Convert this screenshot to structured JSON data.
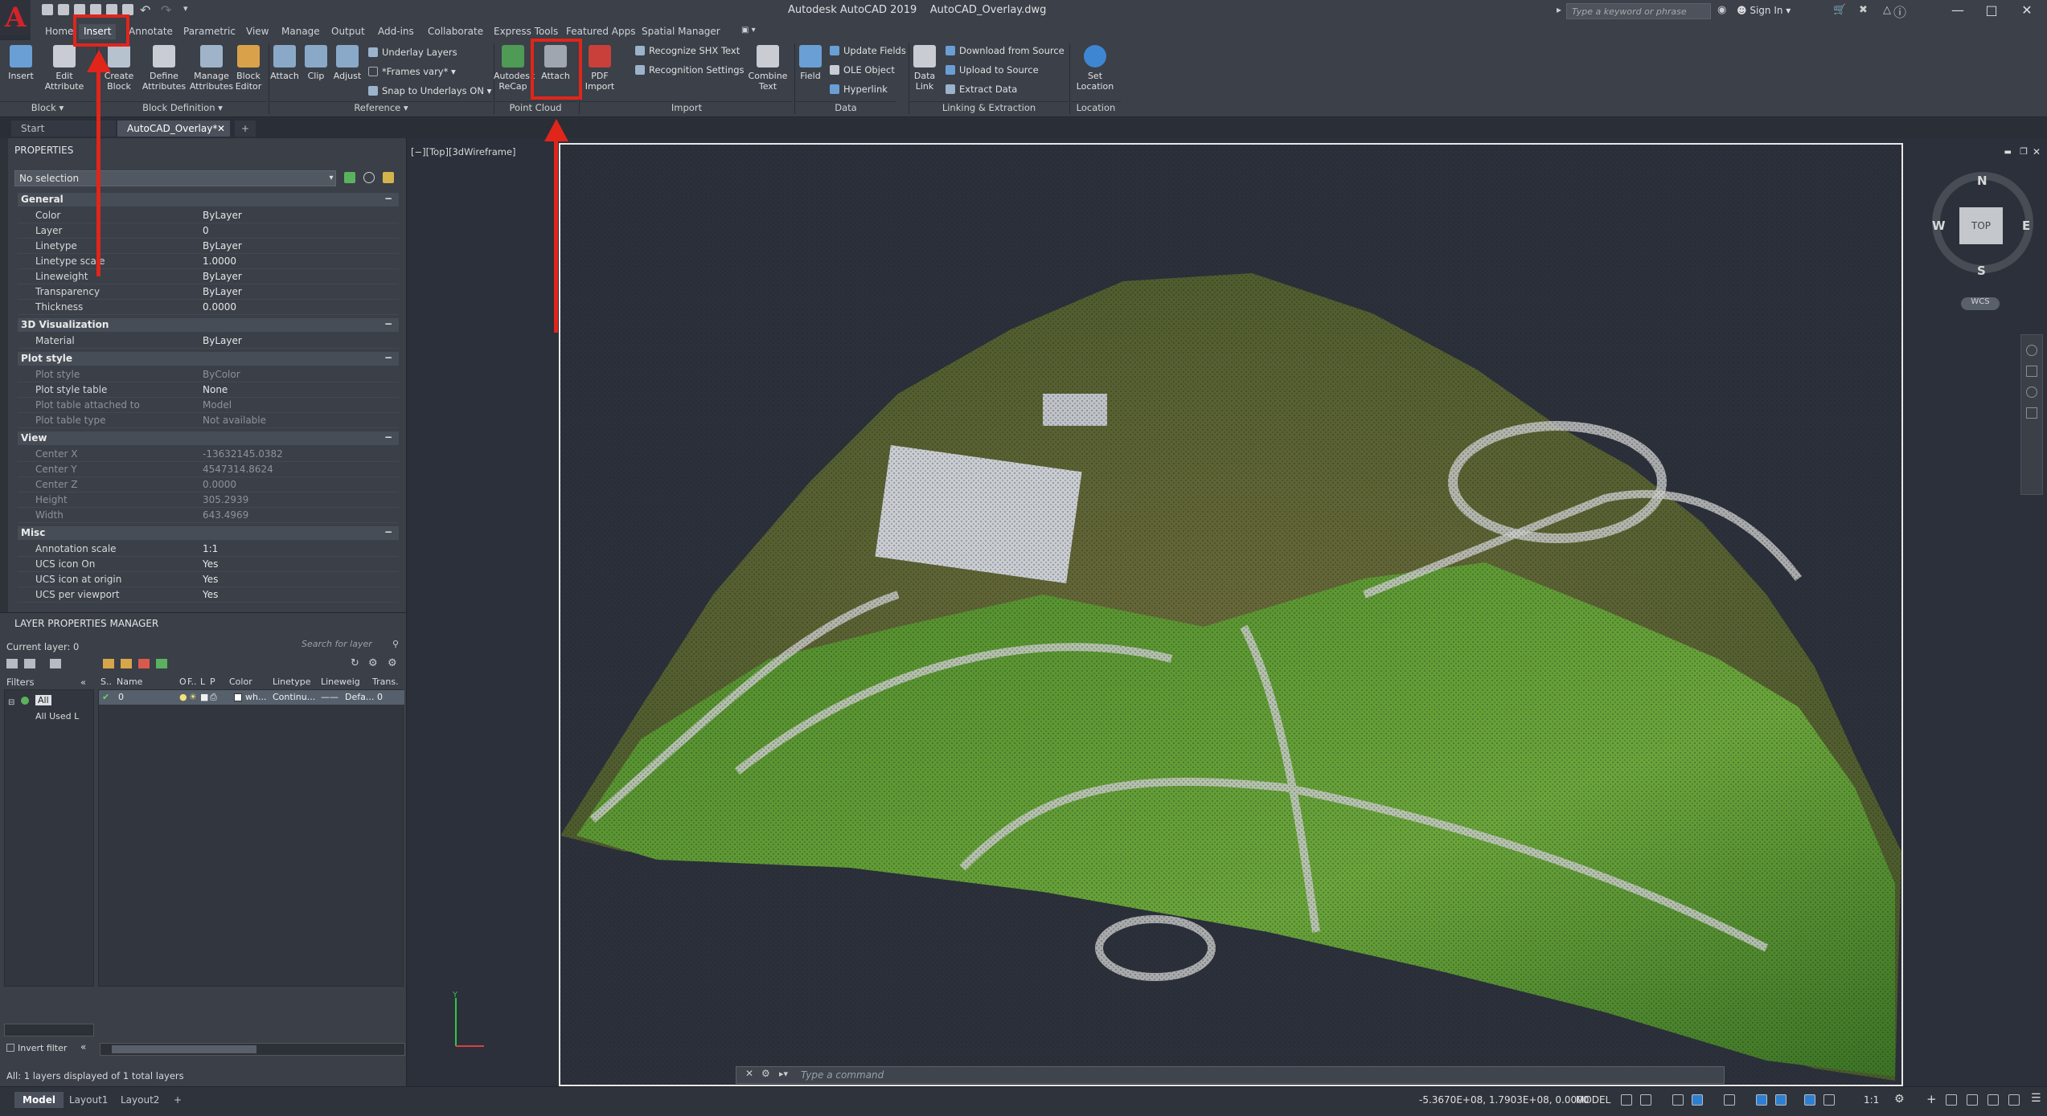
{
  "app": {
    "logo": "A",
    "title": "Autodesk AutoCAD 2019    AutoCAD_Overlay.dwg",
    "search_placeholder": "Type a keyword or phrase",
    "sign_in": "Sign In",
    "min": "—",
    "max": "□",
    "close": "✕"
  },
  "tabs": [
    "Home",
    "Insert",
    "Annotate",
    "Parametric",
    "View",
    "Manage",
    "Output",
    "Add-ins",
    "Collaborate",
    "Express Tools",
    "Featured Apps",
    "Spatial Manager"
  ],
  "active_tab": "Insert",
  "ribbon": {
    "block": {
      "insert": "Insert",
      "edit_attribute": "Edit\nAttribute",
      "panel": "Block ▾"
    },
    "block_def": {
      "create_block": "Create\nBlock",
      "define_attributes": "Define\nAttributes",
      "manage_attributes": "Manage\nAttributes",
      "block_editor": "Block\nEditor",
      "panel": "Block Definition ▾"
    },
    "reference": {
      "attach": "Attach",
      "clip": "Clip",
      "adjust": "Adjust",
      "underlay_layers": "Underlay Layers",
      "frames_vary": "*Frames vary*",
      "snap_underlays": "Snap to Underlays ON",
      "panel": "Reference ▾"
    },
    "point_cloud": {
      "recap": "Autodesk\nReCap",
      "attach": "Attach",
      "panel": "Point Cloud"
    },
    "import": {
      "pdf_import": "PDF\nImport",
      "recognize_shx": "Recognize SHX Text",
      "recognition_settings": "Recognition Settings",
      "combine_text": "Combine\nText",
      "panel": "Import"
    },
    "data": {
      "field": "Field",
      "update_fields": "Update Fields",
      "ole_object": "OLE Object",
      "hyperlink": "Hyperlink",
      "panel": "Data"
    },
    "linking": {
      "data_link": "Data\nLink",
      "download_source": "Download from Source",
      "upload_source": "Upload to Source",
      "extract_data": "Extract  Data",
      "panel": "Linking & Extraction"
    },
    "location": {
      "set_location": "Set\nLocation",
      "panel": "Location"
    }
  },
  "doc_tabs": [
    "Start",
    "AutoCAD_Overlay*"
  ],
  "properties": {
    "title": "PROPERTIES",
    "selection": "No selection",
    "sections": [
      {
        "name": "General",
        "rows": [
          [
            "Color",
            "ByLayer"
          ],
          [
            "Layer",
            "0"
          ],
          [
            "Linetype",
            "ByLayer"
          ],
          [
            "Linetype scale",
            "1.0000"
          ],
          [
            "Lineweight",
            "ByLayer"
          ],
          [
            "Transparency",
            "ByLayer"
          ],
          [
            "Thickness",
            "0.0000"
          ]
        ]
      },
      {
        "name": "3D Visualization",
        "rows": [
          [
            "Material",
            "ByLayer"
          ]
        ]
      },
      {
        "name": "Plot style",
        "rows": [
          [
            "Plot style",
            "ByColor"
          ],
          [
            "Plot style table",
            "None"
          ],
          [
            "Plot table attached to",
            "Model"
          ],
          [
            "Plot table type",
            "Not available"
          ]
        ]
      },
      {
        "name": "View",
        "rows": [
          [
            "Center X",
            "-13632145.0382"
          ],
          [
            "Center Y",
            "4547314.8624"
          ],
          [
            "Center Z",
            "0.0000"
          ],
          [
            "Height",
            "305.2939"
          ],
          [
            "Width",
            "643.4969"
          ]
        ]
      },
      {
        "name": "Misc",
        "rows": [
          [
            "Annotation scale",
            "1:1"
          ],
          [
            "UCS icon On",
            "Yes"
          ],
          [
            "UCS icon at origin",
            "Yes"
          ],
          [
            "UCS per viewport",
            "Yes"
          ]
        ]
      }
    ]
  },
  "layers": {
    "title": "LAYER PROPERTIES MANAGER",
    "current": "Current layer: 0",
    "search": "Search for layer",
    "filters_label": "Filters",
    "filter_all": "All",
    "filter_used": "All Used L",
    "columns": [
      "S..",
      "Name",
      "O",
      "F..",
      "L",
      "P",
      "Color",
      "Linetype",
      "Lineweig",
      "Trans."
    ],
    "row": {
      "name": "0",
      "color": "wh...",
      "linetype": "Continu...",
      "lineweight": "Defa...",
      "trans": "0"
    },
    "invert_filter": "Invert filter",
    "status": "All: 1 layers displayed of 1 total layers"
  },
  "viewport": {
    "label": "[−][Top][3dWireframe]",
    "cube": {
      "n": "N",
      "s": "S",
      "e": "E",
      "w": "W",
      "top": "TOP",
      "wcs": "WCS"
    },
    "command_placeholder": "Type  a  command"
  },
  "status": {
    "layouts": [
      "Model",
      "Layout1",
      "Layout2"
    ],
    "coords": "-5.3670E+08, 1.7903E+08, 0.0000",
    "mode": "MODEL",
    "scale": "1:1"
  },
  "colors": {
    "accent_red": "#e1251b",
    "ribbon_bg": "#3b4049"
  }
}
